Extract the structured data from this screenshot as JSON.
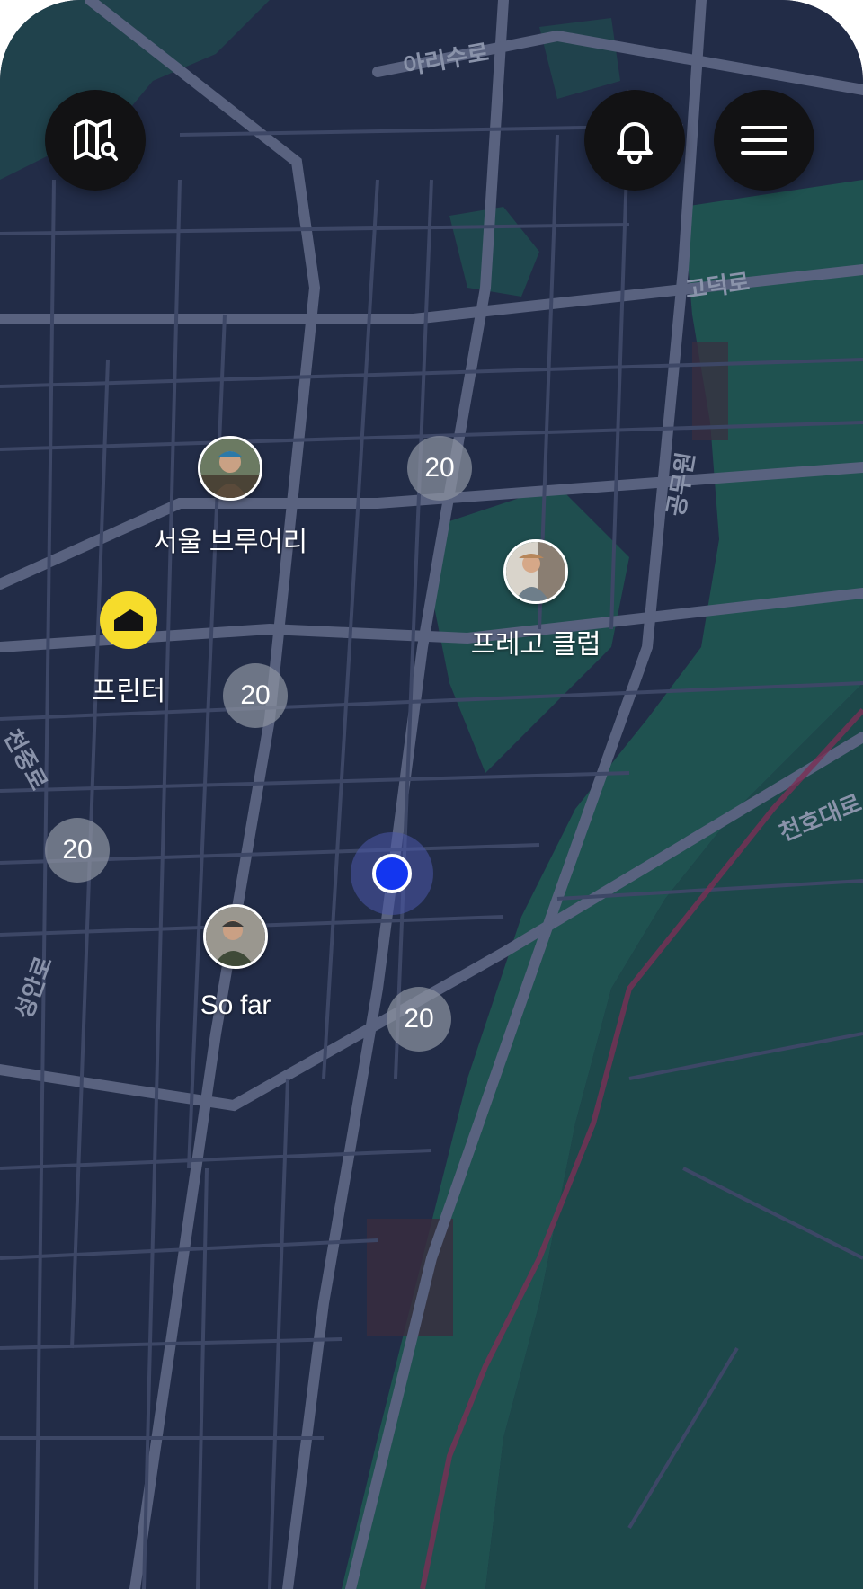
{
  "top_bar": {
    "left_button_icon": "map-search-icon",
    "right_buttons": [
      {
        "icon": "bell-icon"
      },
      {
        "icon": "menu-icon"
      }
    ]
  },
  "road_labels": [
    "아리수로",
    "고덕로",
    "공무원",
    "천호대로",
    "천중로",
    "성안로"
  ],
  "places": [
    {
      "name": "서울 브루어리",
      "kind": "avatar"
    },
    {
      "name": "프레고 클럽",
      "kind": "avatar"
    },
    {
      "name": "프린터",
      "kind": "yellow-pin"
    },
    {
      "name": "So far",
      "kind": "avatar"
    }
  ],
  "clusters": [
    {
      "count": "20"
    },
    {
      "count": "20"
    },
    {
      "count": "20"
    },
    {
      "count": "20"
    }
  ],
  "colors": {
    "map_background": "#222c47",
    "road": "#5a6485",
    "park": "#1f5a52",
    "button": "#121214",
    "yellow_pin": "#f6dc2b",
    "location_dot": "#1336f0",
    "cluster": "#8a92a0"
  }
}
